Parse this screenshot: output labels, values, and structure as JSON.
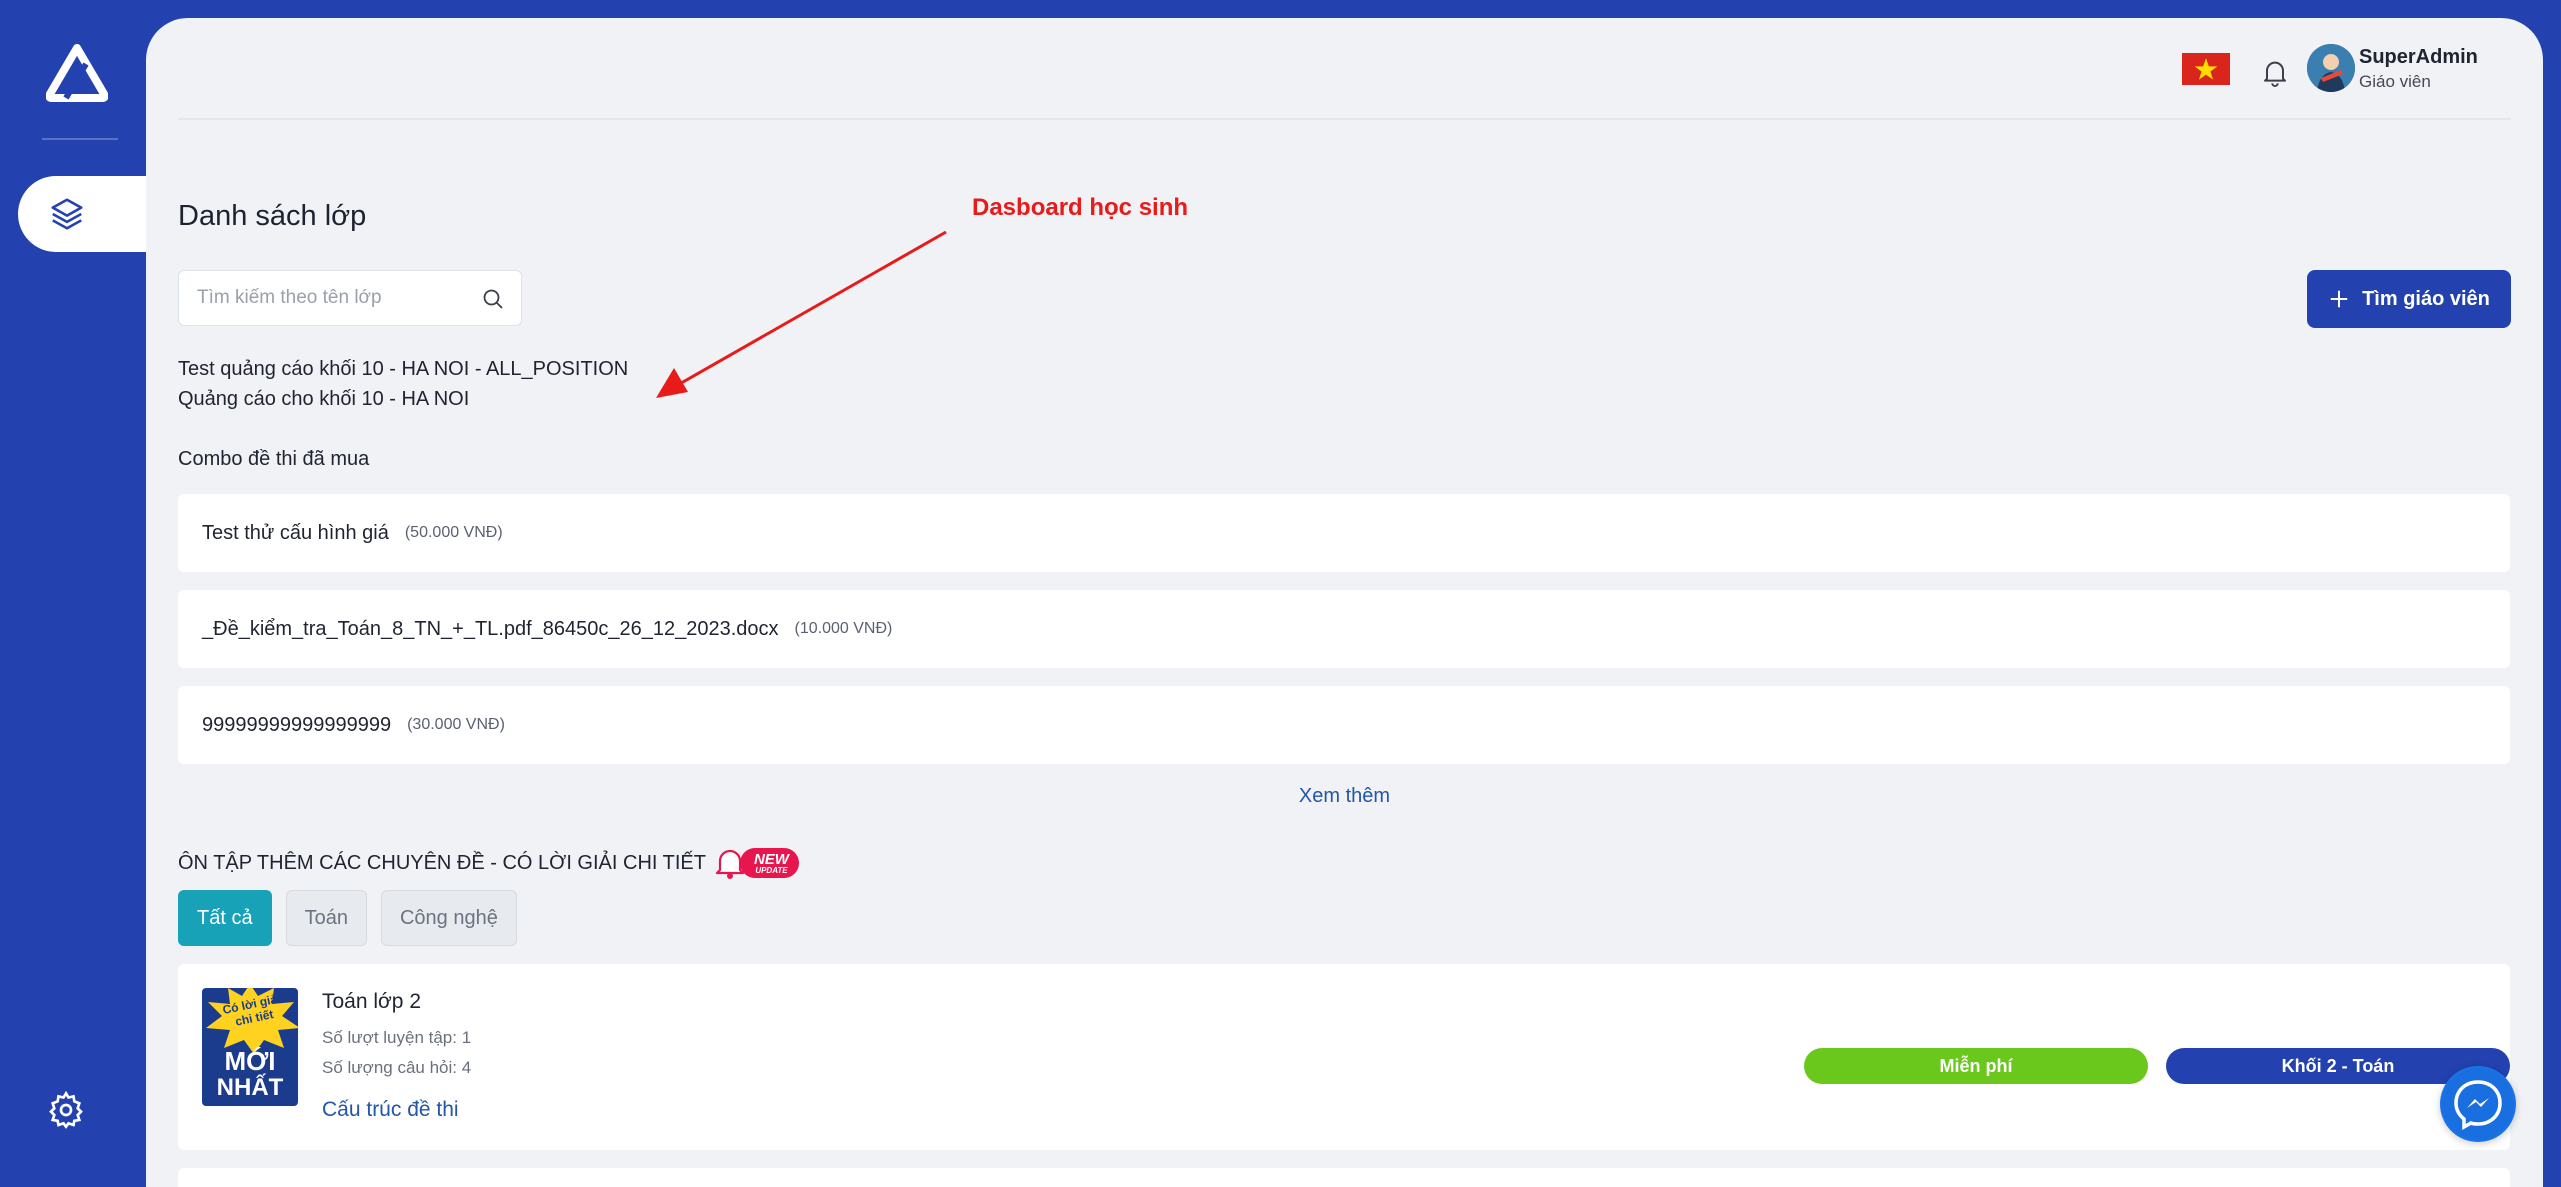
{
  "header": {
    "user_name": "SuperAdmin",
    "user_role": "Giáo viên"
  },
  "page": {
    "title": "Danh sách lớp",
    "annotation": "Dasboard học sinh"
  },
  "search": {
    "placeholder": "Tìm kiếm theo tên lớp",
    "value": ""
  },
  "actions": {
    "find_teacher_label": "Tìm giáo viên"
  },
  "ads": [
    "Test quảng cáo khối 10 - HA NOI - ALL_POSITION",
    "Quảng cáo cho khối 10 - HA NOI"
  ],
  "combos": {
    "section_label": "Combo đề thi đã mua",
    "items": [
      {
        "name": "Test thử cấu hình giá",
        "price": "(50.000 VNĐ)"
      },
      {
        "name": "_Đề_kiểm_tra_Toán_8_TN_+_TL.pdf_86450c_26_12_2023.docx",
        "price": "(10.000 VNĐ)"
      },
      {
        "name": "99999999999999999",
        "price": "(30.000 VNĐ)"
      }
    ],
    "more_label": "Xem thêm"
  },
  "review": {
    "title": "ÔN TẬP THÊM CÁC CHUYÊN ĐỀ - CÓ LỜI GIẢI CHI TIẾT",
    "badge_line1": "NEW",
    "badge_line2": "UPDATE",
    "tabs": [
      {
        "label": "Tất cả",
        "active": true
      },
      {
        "label": "Toán",
        "active": false
      },
      {
        "label": "Công nghệ",
        "active": false
      }
    ]
  },
  "course": {
    "thumb_star_text": "Có lời giải chi tiết",
    "thumb_line1": "MỚI",
    "thumb_line2": "NHẤT",
    "title": "Toán lớp 2",
    "practice_count": "Số lượt luyện tập: 1",
    "question_count": "Số lượng câu hỏi: 4",
    "structure_link": "Cấu trúc đề thi",
    "price_badge": "Miễn phí",
    "grade_badge": "Khối 2 - Toán"
  },
  "colors": {
    "brand": "#2342b0",
    "tab_active": "#17a2b8",
    "free_badge": "#6ac81d",
    "annotation": "#e81a1a",
    "link": "#2355a8"
  },
  "icons": [
    "logo-icon",
    "layers-icon",
    "settings-icon",
    "vietnam-flag-icon",
    "bell-icon",
    "avatar",
    "search-icon",
    "plus-icon",
    "bell-badge-icon",
    "messenger-icon"
  ]
}
